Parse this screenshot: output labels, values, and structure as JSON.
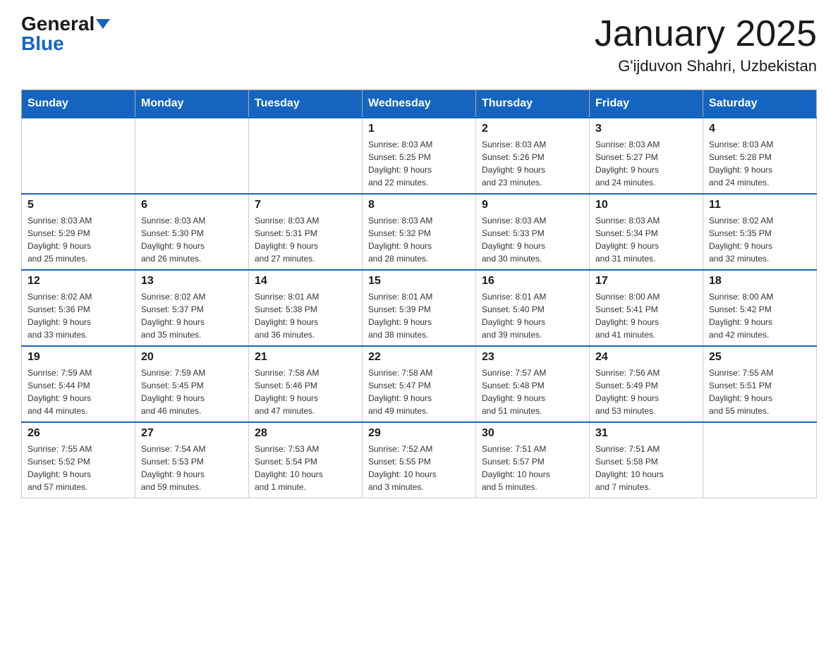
{
  "header": {
    "logo_general": "General",
    "logo_blue": "Blue",
    "month_title": "January 2025",
    "location": "G'ijduvon Shahri, Uzbekistan"
  },
  "weekdays": [
    "Sunday",
    "Monday",
    "Tuesday",
    "Wednesday",
    "Thursday",
    "Friday",
    "Saturday"
  ],
  "weeks": [
    [
      {
        "day": "",
        "info": ""
      },
      {
        "day": "",
        "info": ""
      },
      {
        "day": "",
        "info": ""
      },
      {
        "day": "1",
        "info": "Sunrise: 8:03 AM\nSunset: 5:25 PM\nDaylight: 9 hours\nand 22 minutes."
      },
      {
        "day": "2",
        "info": "Sunrise: 8:03 AM\nSunset: 5:26 PM\nDaylight: 9 hours\nand 23 minutes."
      },
      {
        "day": "3",
        "info": "Sunrise: 8:03 AM\nSunset: 5:27 PM\nDaylight: 9 hours\nand 24 minutes."
      },
      {
        "day": "4",
        "info": "Sunrise: 8:03 AM\nSunset: 5:28 PM\nDaylight: 9 hours\nand 24 minutes."
      }
    ],
    [
      {
        "day": "5",
        "info": "Sunrise: 8:03 AM\nSunset: 5:29 PM\nDaylight: 9 hours\nand 25 minutes."
      },
      {
        "day": "6",
        "info": "Sunrise: 8:03 AM\nSunset: 5:30 PM\nDaylight: 9 hours\nand 26 minutes."
      },
      {
        "day": "7",
        "info": "Sunrise: 8:03 AM\nSunset: 5:31 PM\nDaylight: 9 hours\nand 27 minutes."
      },
      {
        "day": "8",
        "info": "Sunrise: 8:03 AM\nSunset: 5:32 PM\nDaylight: 9 hours\nand 28 minutes."
      },
      {
        "day": "9",
        "info": "Sunrise: 8:03 AM\nSunset: 5:33 PM\nDaylight: 9 hours\nand 30 minutes."
      },
      {
        "day": "10",
        "info": "Sunrise: 8:03 AM\nSunset: 5:34 PM\nDaylight: 9 hours\nand 31 minutes."
      },
      {
        "day": "11",
        "info": "Sunrise: 8:02 AM\nSunset: 5:35 PM\nDaylight: 9 hours\nand 32 minutes."
      }
    ],
    [
      {
        "day": "12",
        "info": "Sunrise: 8:02 AM\nSunset: 5:36 PM\nDaylight: 9 hours\nand 33 minutes."
      },
      {
        "day": "13",
        "info": "Sunrise: 8:02 AM\nSunset: 5:37 PM\nDaylight: 9 hours\nand 35 minutes."
      },
      {
        "day": "14",
        "info": "Sunrise: 8:01 AM\nSunset: 5:38 PM\nDaylight: 9 hours\nand 36 minutes."
      },
      {
        "day": "15",
        "info": "Sunrise: 8:01 AM\nSunset: 5:39 PM\nDaylight: 9 hours\nand 38 minutes."
      },
      {
        "day": "16",
        "info": "Sunrise: 8:01 AM\nSunset: 5:40 PM\nDaylight: 9 hours\nand 39 minutes."
      },
      {
        "day": "17",
        "info": "Sunrise: 8:00 AM\nSunset: 5:41 PM\nDaylight: 9 hours\nand 41 minutes."
      },
      {
        "day": "18",
        "info": "Sunrise: 8:00 AM\nSunset: 5:42 PM\nDaylight: 9 hours\nand 42 minutes."
      }
    ],
    [
      {
        "day": "19",
        "info": "Sunrise: 7:59 AM\nSunset: 5:44 PM\nDaylight: 9 hours\nand 44 minutes."
      },
      {
        "day": "20",
        "info": "Sunrise: 7:59 AM\nSunset: 5:45 PM\nDaylight: 9 hours\nand 46 minutes."
      },
      {
        "day": "21",
        "info": "Sunrise: 7:58 AM\nSunset: 5:46 PM\nDaylight: 9 hours\nand 47 minutes."
      },
      {
        "day": "22",
        "info": "Sunrise: 7:58 AM\nSunset: 5:47 PM\nDaylight: 9 hours\nand 49 minutes."
      },
      {
        "day": "23",
        "info": "Sunrise: 7:57 AM\nSunset: 5:48 PM\nDaylight: 9 hours\nand 51 minutes."
      },
      {
        "day": "24",
        "info": "Sunrise: 7:56 AM\nSunset: 5:49 PM\nDaylight: 9 hours\nand 53 minutes."
      },
      {
        "day": "25",
        "info": "Sunrise: 7:55 AM\nSunset: 5:51 PM\nDaylight: 9 hours\nand 55 minutes."
      }
    ],
    [
      {
        "day": "26",
        "info": "Sunrise: 7:55 AM\nSunset: 5:52 PM\nDaylight: 9 hours\nand 57 minutes."
      },
      {
        "day": "27",
        "info": "Sunrise: 7:54 AM\nSunset: 5:53 PM\nDaylight: 9 hours\nand 59 minutes."
      },
      {
        "day": "28",
        "info": "Sunrise: 7:53 AM\nSunset: 5:54 PM\nDaylight: 10 hours\nand 1 minute."
      },
      {
        "day": "29",
        "info": "Sunrise: 7:52 AM\nSunset: 5:55 PM\nDaylight: 10 hours\nand 3 minutes."
      },
      {
        "day": "30",
        "info": "Sunrise: 7:51 AM\nSunset: 5:57 PM\nDaylight: 10 hours\nand 5 minutes."
      },
      {
        "day": "31",
        "info": "Sunrise: 7:51 AM\nSunset: 5:58 PM\nDaylight: 10 hours\nand 7 minutes."
      },
      {
        "day": "",
        "info": ""
      }
    ]
  ]
}
